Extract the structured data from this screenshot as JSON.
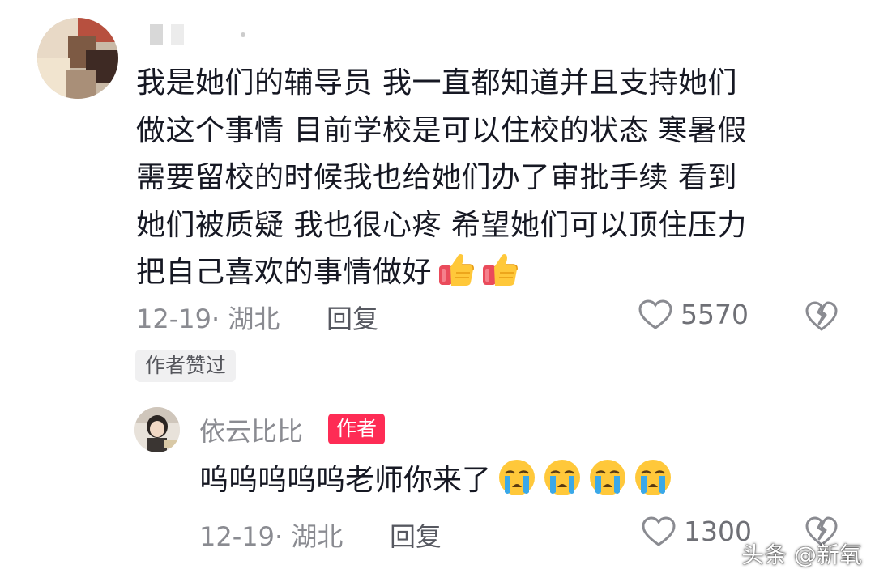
{
  "comment": {
    "lines": [
      "我是她们的辅导员 我一直都知道并且支持她们",
      "做这个事情 目前学校是可以住校的状态 寒暑假",
      "需要留校的时候我也给她们办了审批手续 看到",
      "她们被质疑 我也很心疼 希望她们可以顶住压力",
      "把自己喜欢的事情做好"
    ],
    "emojis": [
      "thumbs-up-icon",
      "thumbs-up-icon"
    ],
    "date_location": "12-19· 湖北",
    "reply_label": "回复",
    "likes": "5570",
    "author_liked_badge": "作者赞过"
  },
  "reply": {
    "username": "依云比比",
    "author_tag": "作者",
    "text": "呜呜呜呜呜老师你来了",
    "emojis": [
      "crying-face-icon",
      "crying-face-icon",
      "crying-face-icon",
      "crying-face-icon"
    ],
    "date_location": "12-19· 湖北",
    "reply_label": "回复",
    "likes": "1300"
  },
  "watermark": "头条 @新氧",
  "colors": {
    "text": "#161823",
    "secondary": "#8a8b91",
    "author_tag_bg": "#fe2c55",
    "badge_bg": "#f0f0f1"
  }
}
